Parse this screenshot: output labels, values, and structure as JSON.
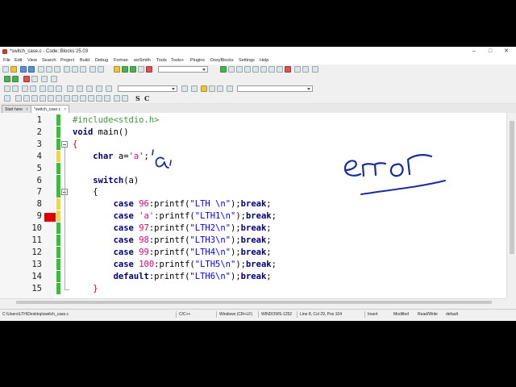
{
  "window": {
    "title": "*switch_case.c - Code::Blocks 25.03"
  },
  "menu": [
    "File",
    "Edit",
    "View",
    "Search",
    "Project",
    "Build",
    "Debug",
    "Fortran",
    "wxSmith",
    "Tools",
    "Tools+",
    "Plugins",
    "DoxyBlocks",
    "Settings",
    "Help"
  ],
  "toolbar": {
    "text_buttons": [
      "S",
      "C"
    ]
  },
  "tabs": [
    {
      "label": "Start here",
      "active": false
    },
    {
      "label": "*switch_case.c",
      "active": true
    }
  ],
  "editor": {
    "line_numbers": [
      "1",
      "2",
      "3",
      "4",
      "5",
      "6",
      "7",
      "8",
      "9",
      "10",
      "11",
      "12",
      "13",
      "14",
      "15"
    ],
    "breakpoint_line": "9",
    "lines": [
      {
        "num": "1",
        "segments": [
          {
            "t": "#include<stdio.h>",
            "c": "pp"
          }
        ]
      },
      {
        "num": "2",
        "segments": [
          {
            "t": "void",
            "c": "kw"
          },
          {
            "t": " main()",
            "c": ""
          }
        ]
      },
      {
        "num": "3",
        "segments": [
          {
            "t": "{",
            "c": "brace"
          }
        ]
      },
      {
        "num": "4",
        "segments": [
          {
            "t": "    ",
            "c": ""
          },
          {
            "t": "char",
            "c": "kw"
          },
          {
            "t": " a=",
            "c": ""
          },
          {
            "t": "'a'",
            "c": "chr"
          },
          {
            "t": ";",
            "c": ""
          }
        ]
      },
      {
        "num": "5",
        "segments": []
      },
      {
        "num": "6",
        "segments": [
          {
            "t": "    ",
            "c": ""
          },
          {
            "t": "switch",
            "c": "kw"
          },
          {
            "t": "(a)",
            "c": ""
          }
        ]
      },
      {
        "num": "7",
        "segments": [
          {
            "t": "    {",
            "c": ""
          }
        ]
      },
      {
        "num": "8",
        "segments": [
          {
            "t": "        ",
            "c": ""
          },
          {
            "t": "case",
            "c": "kw"
          },
          {
            "t": " ",
            "c": ""
          },
          {
            "t": "96",
            "c": "num"
          },
          {
            "t": ":printf(",
            "c": ""
          },
          {
            "t": "\"LTH \\n\"",
            "c": "str"
          },
          {
            "t": ");",
            "c": ""
          },
          {
            "t": "break",
            "c": "kw"
          },
          {
            "t": ";",
            "c": ""
          }
        ]
      },
      {
        "num": "9",
        "segments": [
          {
            "t": "        ",
            "c": ""
          },
          {
            "t": "case",
            "c": "kw"
          },
          {
            "t": " ",
            "c": ""
          },
          {
            "t": "'a'",
            "c": "chr"
          },
          {
            "t": ":printf(",
            "c": ""
          },
          {
            "t": "\"LTH1\\n\"",
            "c": "str"
          },
          {
            "t": ");",
            "c": ""
          },
          {
            "t": "break",
            "c": "kw"
          },
          {
            "t": ";",
            "c": ""
          }
        ]
      },
      {
        "num": "10",
        "segments": [
          {
            "t": "        ",
            "c": ""
          },
          {
            "t": "case",
            "c": "kw"
          },
          {
            "t": " ",
            "c": ""
          },
          {
            "t": "97",
            "c": "num"
          },
          {
            "t": ":printf(",
            "c": ""
          },
          {
            "t": "\"LTH2\\n\"",
            "c": "str"
          },
          {
            "t": ");",
            "c": ""
          },
          {
            "t": "break",
            "c": "kw"
          },
          {
            "t": ";",
            "c": ""
          }
        ]
      },
      {
        "num": "11",
        "segments": [
          {
            "t": "        ",
            "c": ""
          },
          {
            "t": "case",
            "c": "kw"
          },
          {
            "t": " ",
            "c": ""
          },
          {
            "t": "98",
            "c": "num"
          },
          {
            "t": ":printf(",
            "c": ""
          },
          {
            "t": "\"LTH3\\n\"",
            "c": "str"
          },
          {
            "t": ");",
            "c": ""
          },
          {
            "t": "break",
            "c": "kw"
          },
          {
            "t": ";",
            "c": ""
          }
        ]
      },
      {
        "num": "12",
        "segments": [
          {
            "t": "        ",
            "c": ""
          },
          {
            "t": "case",
            "c": "kw"
          },
          {
            "t": " ",
            "c": ""
          },
          {
            "t": "99",
            "c": "num"
          },
          {
            "t": ":printf(",
            "c": ""
          },
          {
            "t": "\"LTH4\\n\"",
            "c": "str"
          },
          {
            "t": ");",
            "c": ""
          },
          {
            "t": "break",
            "c": "kw"
          },
          {
            "t": ";",
            "c": ""
          }
        ]
      },
      {
        "num": "13",
        "segments": [
          {
            "t": "        ",
            "c": ""
          },
          {
            "t": "case",
            "c": "kw"
          },
          {
            "t": " ",
            "c": ""
          },
          {
            "t": "100",
            "c": "num"
          },
          {
            "t": ":printf(",
            "c": ""
          },
          {
            "t": "\"LTH5\\n\"",
            "c": "str"
          },
          {
            "t": ");",
            "c": ""
          },
          {
            "t": "break",
            "c": "kw"
          },
          {
            "t": ";",
            "c": ""
          }
        ]
      },
      {
        "num": "14",
        "segments": [
          {
            "t": "        ",
            "c": ""
          },
          {
            "t": "default",
            "c": "kw"
          },
          {
            "t": ":printf(",
            "c": ""
          },
          {
            "t": "\"LTH6\\n\"",
            "c": "str"
          },
          {
            "t": ");",
            "c": ""
          },
          {
            "t": "break",
            "c": "kw"
          },
          {
            "t": ";",
            "c": ""
          }
        ]
      },
      {
        "num": "15",
        "segments": [
          {
            "t": "    }",
            "c": "brace"
          }
        ]
      }
    ]
  },
  "annotations": {
    "handwritten_word": "error",
    "handwritten_char": "'a'",
    "ink_color": "#1a2b9c"
  },
  "statusbar": {
    "path": "C:\\Users\\LTH\\Desktop\\switch_case.c",
    "language": "C/C++",
    "line_endings": "Windows (CR+LF)",
    "encoding": "WINDOWS-1252",
    "position": "Line 8, Col 29, Pos 104",
    "insert_mode": "Insert",
    "modified": "Modified",
    "access": "Read/Write",
    "profile": "default"
  },
  "colors": {
    "breakpoint": "#e00000",
    "changed_marker_yellow": "#f5d442",
    "changed_marker_green": "#34c234"
  }
}
